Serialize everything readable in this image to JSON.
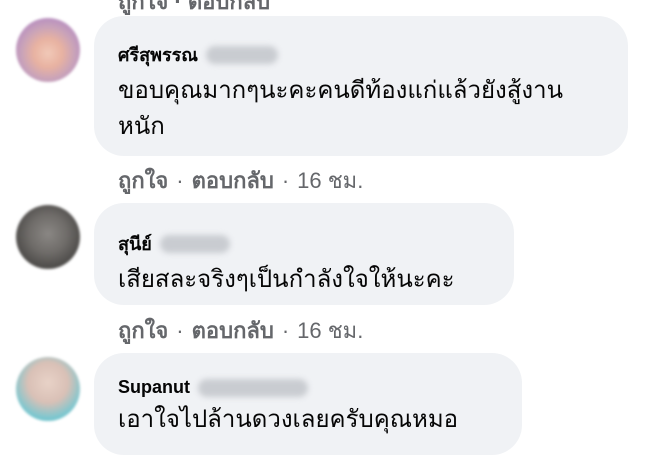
{
  "comments": [
    {
      "author": "ศรีสุพรรณ",
      "text": "ขอบคุณมากๆนะคะคนดีท้องแก่แล้วยังสู้งานหนัก",
      "actions": {
        "like": "ถูกใจ",
        "reply": "ตอบกลับ",
        "time": "16 ชม."
      }
    },
    {
      "author": "สุนีย์",
      "text": "เสียสละจริงๆเป็นกำลังใจให้นะคะ",
      "actions": {
        "like": "ถูกใจ",
        "reply": "ตอบกลับ",
        "time": "16 ชม."
      }
    },
    {
      "author": "Supanut",
      "text": "เอาใจไปล้านดวงเลยครับคุณหมอ"
    }
  ],
  "separator": "·",
  "colors": {
    "bubble": "#f0f2f5",
    "meta": "#65676b",
    "text": "#050505"
  }
}
